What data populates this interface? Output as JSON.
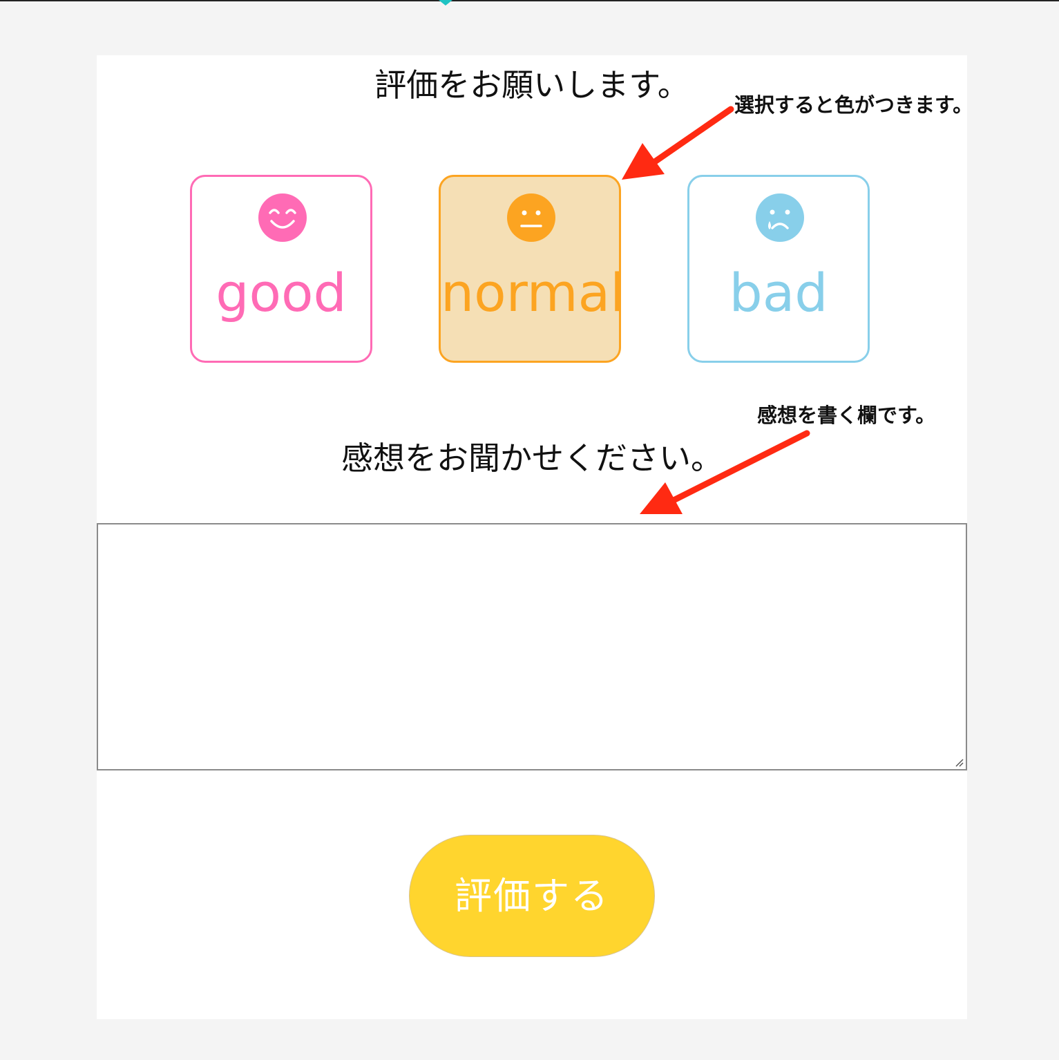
{
  "page": {
    "rating_prompt": "評価をお願いします。",
    "comment_prompt": "感想をお聞かせください。",
    "submit_label": "評価する"
  },
  "options": [
    {
      "key": "good",
      "label": "good",
      "icon": "smile-face-icon",
      "color": "#ff6bb5",
      "selected": false
    },
    {
      "key": "normal",
      "label": "normal",
      "icon": "neutral-face-icon",
      "color": "#fca421",
      "selected": true
    },
    {
      "key": "bad",
      "label": "bad",
      "icon": "crying-face-icon",
      "color": "#88cfea",
      "selected": false
    }
  ],
  "comment_field": {
    "value": "",
    "placeholder": ""
  },
  "annotations": {
    "select_note": "選択すると色がつきます。",
    "comment_note": "感想を書く欄です。"
  },
  "colors": {
    "submit_bg": "#ffd52e",
    "arrow": "#ff2a12",
    "selected_bg": "#f5dfb5",
    "page_bg": "#f4f4f4"
  }
}
